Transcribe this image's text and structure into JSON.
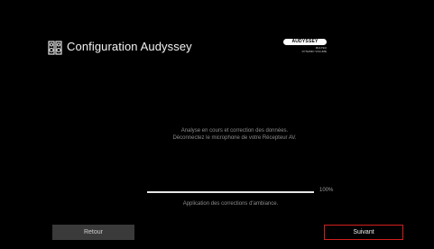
{
  "header": {
    "title": "Configuration Audyssey",
    "icon": "speaker-pair-icon"
  },
  "brand": {
    "name": "AUDYSSEY",
    "sub_line1": "MULTEQ",
    "sub_line2": "DYNAMIC VOLUME"
  },
  "message": {
    "line1": "Analyse en cours et correction des données.",
    "line2": "Déconnectez le microphone de votre Récepteur AV."
  },
  "progress": {
    "value": 1.0,
    "percent_label": "100%",
    "caption": "Application des corrections d'ambiance."
  },
  "buttons": {
    "back_label": "Retour",
    "next_label": "Suivant"
  },
  "colors": {
    "background": "#000000",
    "focus_border": "#d21f1f",
    "back_button_bg": "#3a3a3a"
  }
}
